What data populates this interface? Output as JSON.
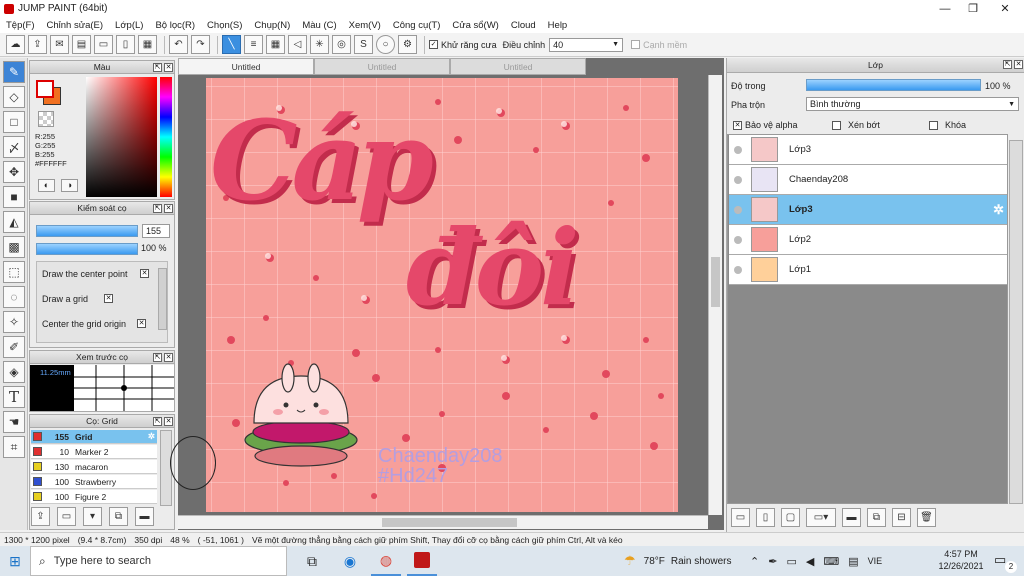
{
  "window": {
    "title": "JUMP PAINT (64bit)"
  },
  "menu": [
    "Tệp(F)",
    "Chỉnh sửa(E)",
    "Lớp(L)",
    "Bộ lọc(R)",
    "Chọn(S)",
    "Chụp(N)",
    "Màu (C)",
    "Xem(V)",
    "Công cụ(T)",
    "Cửa sổ(W)",
    "Cloud",
    "Help"
  ],
  "toolbar": {
    "antialias_label": "Khử răng cưa",
    "adjust_label": "Điều chỉnh",
    "adjust_value": "40",
    "edge_label": "Cạnh mềm"
  },
  "color_panel": {
    "title": "Màu",
    "r": "R:255",
    "g": "G:255",
    "b": "B:255",
    "hex": "#FFFFFF",
    "foreground": "#ffffff",
    "background": "#f07020"
  },
  "brush_control": {
    "title": "Kiểm soát cọ",
    "size_value": "155",
    "opacity_text": "100 %",
    "opacity_fraction": 1.0,
    "options": [
      "Draw the center point",
      "Draw a grid",
      "Center the grid origin"
    ]
  },
  "brush_preview": {
    "title": "Xem trước cọ",
    "size_label": "11.25mm"
  },
  "brush_list": {
    "title": "Cọ: Grid",
    "items": [
      {
        "size": "155",
        "name": "Grid",
        "color": "#e03030"
      },
      {
        "size": "10",
        "name": "Marker 2",
        "color": "#e03030"
      },
      {
        "size": "130",
        "name": "macaron",
        "color": "#e8d020"
      },
      {
        "size": "100",
        "name": "Strawberry",
        "color": "#3050d0"
      },
      {
        "size": "100",
        "name": "Figure 2",
        "color": "#e8d020"
      }
    ]
  },
  "tabs": [
    "Untitled",
    "Untitled",
    "Untitled"
  ],
  "artwork": {
    "line1": "Cáp",
    "line2": "đôi",
    "credit1": "Chaenday208",
    "credit2": "#Hd247"
  },
  "layers_panel": {
    "title": "Lớp",
    "opacity_label": "Độ trong",
    "opacity_text": "100 %",
    "opacity_fraction": 1.0,
    "blend_label": "Pha trộn",
    "blend_value": "Bình thường",
    "protect_alpha": "Bảo vệ alpha",
    "clipping": "Xén bớt",
    "lock": "Khóa",
    "layers": [
      {
        "name": "Lớp3",
        "selected": false,
        "thumb": "#f5c8c8"
      },
      {
        "name": "Chaenday208",
        "selected": false,
        "thumb": "#e8e4f4"
      },
      {
        "name": "Lớp3",
        "selected": true,
        "thumb": "#f5c8c8"
      },
      {
        "name": "Lớp2",
        "selected": false,
        "thumb": "#f79f9a"
      },
      {
        "name": "Lớp1",
        "selected": false,
        "thumb": "#ffd09a"
      }
    ]
  },
  "status": {
    "size": "1300 * 1200 pixel",
    "dimensions": "(9.4 * 8.7cm)",
    "dpi": "350 dpi",
    "zoom": "48 %",
    "coords": "( -51, 1061 )",
    "hint": "Vẽ một đường thẳng bằng cách giữ phím Shift, Thay đổi cỡ cọ bằng cách giữ phím Ctrl, Alt và kéo"
  },
  "taskbar": {
    "search_placeholder": "Type here to search",
    "weather_temp": "78°F",
    "weather_desc": "Rain showers",
    "lang": "VIE",
    "time": "4:57 PM",
    "date": "12/26/2021",
    "notification_count": "2"
  }
}
